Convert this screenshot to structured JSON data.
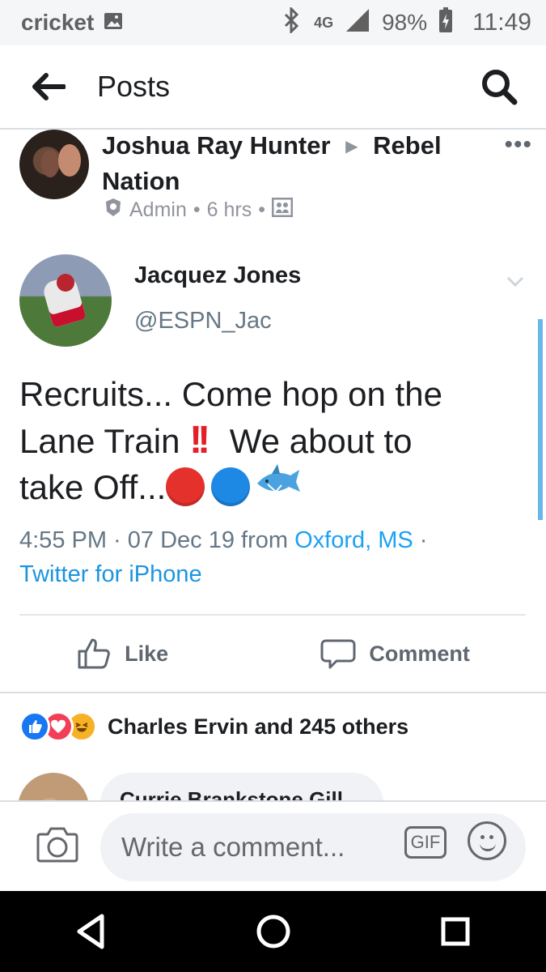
{
  "status_bar": {
    "carrier": "cricket",
    "network": "4G",
    "battery": "98%",
    "time": "11:49"
  },
  "header": {
    "title": "Posts"
  },
  "post": {
    "author": "Joshua Ray Hunter",
    "group": "Rebel Nation",
    "role": "Admin",
    "age": "6 hrs",
    "separator": "•"
  },
  "tweet": {
    "display_name": "Jacquez Jones",
    "handle": "@ESPN_Jac",
    "line1": "Recruits... Come hop on the",
    "line2_start": "Lane Train",
    "line2_end": "We about to",
    "line3_start": "take Off...",
    "time_prefix": "4:55 PM · 07 Dec 19 from ",
    "location": "Oxford, MS",
    "time_suffix": " ·",
    "source": "Twitter for iPhone"
  },
  "actions": {
    "like_label": "Like",
    "comment_label": "Comment"
  },
  "reactions": {
    "summary": "Charles Ervin and 245 others"
  },
  "comment_preview": {
    "author": "Currie Brankstone Gill"
  },
  "composer": {
    "placeholder": "Write a comment...",
    "gif_label": "GIF"
  },
  "colors": {
    "facebook_blue": "#1877f2",
    "twitter_blue": "#1da1f2",
    "red_emoji": "#e5312c",
    "blue_emoji": "#1e88e5"
  }
}
